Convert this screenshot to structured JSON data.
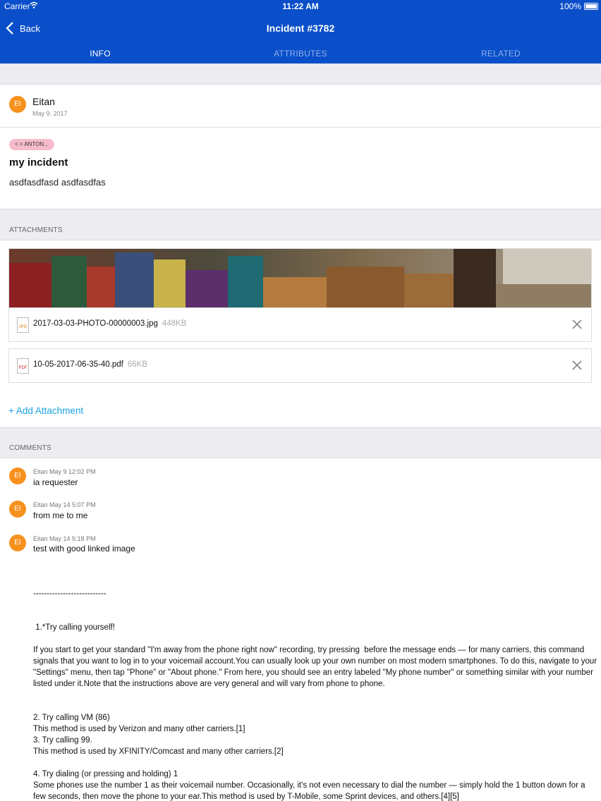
{
  "status_bar": {
    "carrier": "Carrier",
    "time": "11:22 AM",
    "battery": "100%"
  },
  "nav": {
    "back_label": "Back",
    "title": "Incident #3782"
  },
  "tabs": [
    {
      "label": "INFO",
      "active": true
    },
    {
      "label": "ATTRIBUTES",
      "active": false
    },
    {
      "label": "RELATED",
      "active": false
    }
  ],
  "incident": {
    "author_initials": "EI",
    "author": "Eitan",
    "date": "May 9, 2017",
    "tag": "< > ANTON...",
    "title": "my incident",
    "description": "asdfasdfasd asdfasdfas"
  },
  "attachments": {
    "section_label": "ATTACHMENTS",
    "files": [
      {
        "icon": "JPG",
        "name": "2017-03-03-PHOTO-00000003.jpg",
        "size": "448KB"
      },
      {
        "icon": "PDF",
        "name": "10-05-2017-06-35-40.pdf",
        "size": "66KB"
      }
    ],
    "add_label": "+ Add Attachment"
  },
  "comments": {
    "section_label": "COMMENTS",
    "items": [
      {
        "initials": "EI",
        "author": "Eitan",
        "time": "May 9 12:02 PM",
        "text": "ia requester"
      },
      {
        "initials": "EI",
        "author": "Eitan",
        "time": "May 14 5:07 PM",
        "text": "from me to me"
      },
      {
        "initials": "EI",
        "author": "Eitan",
        "time": "May 14 5:18 PM",
        "text": "test with good linked image"
      }
    ],
    "long_body": {
      "separator": "---------------------------",
      "step1_heading": " 1.*Try calling yourself!",
      "para1": "If you start to get your standard \"I'm away from the phone right now\" recording, try pressing  before the message ends — for many carriers, this command signals that you want to log in to your voicemail account.You can usually look up your own number on most modern smartphones. To do this, navigate to your \"Settings\" menu, then tap \"Phone\" or \"About phone.\" From here, you should see an entry labeled \"My phone number\" or something similar with your number listed under it.Note that the instructions above are very general and will vary from phone to phone.",
      "para2": "2. Try calling VM (86)\nThis method is used by Verizon and many other carriers.[1]\n3. Try calling 99.\nThis method is used by XFINITY/Comcast and many other carriers.[2]",
      "para3": "4. Try dialing (or pressing and holding) 1\nSome phones use the number 1 as their voicemail number. Occasionally, it's not even necessary to dial the number — simply hold the 1 button down for a few seconds, then move the phone to your ear.This method is used by T-Mobile, some Sprint devices, and others.[4][5]"
    }
  }
}
